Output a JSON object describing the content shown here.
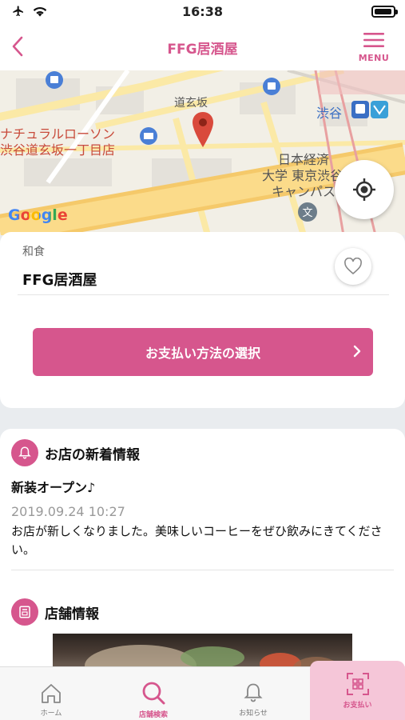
{
  "status_bar": {
    "time": "16:38"
  },
  "header": {
    "title": "FFG居酒屋",
    "menu_label": "MENU"
  },
  "map": {
    "labels": [
      "道玄坂",
      "ナチュラルローソン",
      "渋谷道玄坂一丁目店",
      "渋谷",
      "日本経済",
      "大学 東京渋谷",
      "キャンパス",
      "Google"
    ]
  },
  "store": {
    "category": "和食",
    "name": "FFG居酒屋",
    "pay_button": "お支払い方法の選択"
  },
  "news": {
    "section_title": "お店の新着情報",
    "title": "新装オープン♪",
    "date": "2019.09.24 10:27",
    "body": "お店が新しくなりました。美味しいコーヒーをぜひ飲みにきてください。"
  },
  "info": {
    "section_title": "店舗情報"
  },
  "tabs": [
    {
      "label": "ホーム",
      "icon": "home-icon"
    },
    {
      "label": "店舗検索",
      "icon": "search-icon"
    },
    {
      "label": "お知らせ",
      "icon": "bell-icon"
    },
    {
      "label": "お支払い",
      "icon": "qr-scan-icon"
    }
  ],
  "colors": {
    "accent": "#d6568d",
    "pay_tab_bg": "#f5c6d8"
  }
}
